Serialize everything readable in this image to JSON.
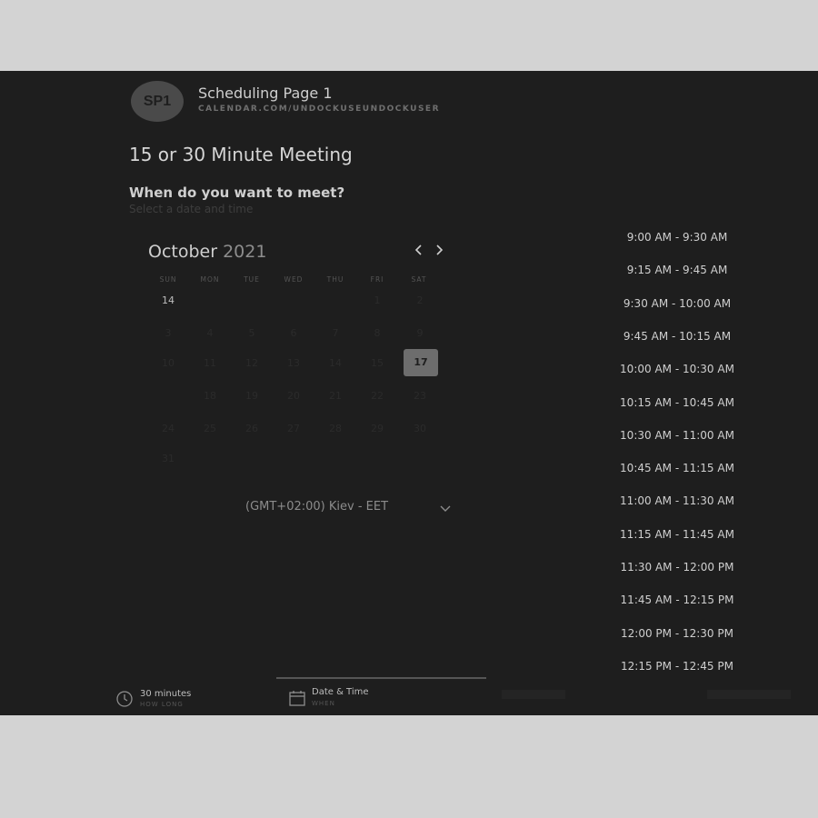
{
  "header": {
    "avatar_initials": "SP1",
    "page_title": "Scheduling Page 1",
    "page_url": "CALENDAR.COM/UNDOCKUSEUNDOCKUSER"
  },
  "meeting": {
    "title": "15 or 30 Minute Meeting",
    "question": "When do you want to meet?",
    "subtitle": "Select a date and time"
  },
  "calendar": {
    "month": "October",
    "year": "2021",
    "prev_icon": "chevron-left-icon",
    "next_icon": "chevron-right-icon",
    "weekdays": [
      "SUN",
      "MON",
      "TUE",
      "WED",
      "THU",
      "FRI",
      "SAT"
    ],
    "weeks": [
      [
        "",
        "",
        "",
        "",
        "",
        "1",
        "2"
      ],
      [
        "3",
        "4",
        "5",
        "6",
        "7",
        "8",
        "9"
      ],
      [
        "10",
        "11",
        "12",
        "13",
        "14",
        "15",
        "16"
      ],
      [
        "17",
        "18",
        "19",
        "20",
        "21",
        "22",
        "23"
      ],
      [
        "24",
        "25",
        "26",
        "27",
        "28",
        "29",
        "30"
      ],
      [
        "31",
        "",
        "",
        "",
        "",
        "",
        ""
      ]
    ],
    "first_row_label": "14",
    "selected_day": "17"
  },
  "timezone": {
    "label": "(GMT+02:00) Kiev - EET",
    "icon": "chevron-down-icon"
  },
  "time_slots": [
    "9:00 AM - 9:30 AM",
    "9:15 AM - 9:45 AM",
    "9:30 AM - 10:00 AM",
    "9:45 AM - 10:15 AM",
    "10:00 AM - 10:30 AM",
    "10:15 AM - 10:45 AM",
    "10:30 AM - 11:00 AM",
    "10:45 AM - 11:15 AM",
    "11:00 AM - 11:30 AM",
    "11:15 AM - 11:45 AM",
    "11:30 AM - 12:00 PM",
    "11:45 AM - 12:15 PM",
    "12:00 PM - 12:30 PM",
    "12:15 PM - 12:45 PM"
  ],
  "footer": {
    "duration_label": "30 minutes",
    "duration_sub": "HOW LONG",
    "duration_icon": "clock-icon",
    "datetime_label": "Date & Time",
    "datetime_sub": "WHEN",
    "datetime_icon": "calendar-icon"
  },
  "colors": {
    "background": "#1e1e1e",
    "selected_day": "#6d6d6d",
    "avatar": "#4a4a4a"
  }
}
